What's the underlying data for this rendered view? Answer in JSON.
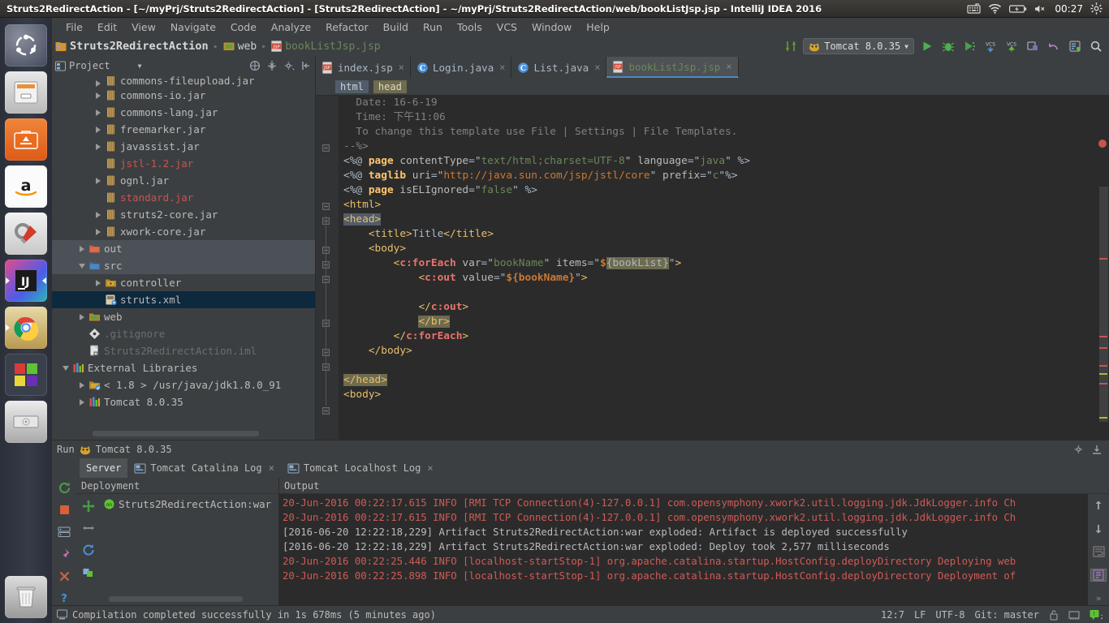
{
  "window": {
    "title": "Struts2RedirectAction - [~/myPrj/Struts2RedirectAction] - [Struts2RedirectAction] - ~/myPrj/Struts2RedirectAction/web/bookListJsp.jsp - IntelliJ IDEA 2016",
    "clock": "00:27"
  },
  "tray": {
    "keyboard": "keyboard-icon",
    "wifi": "wifi-icon",
    "battery": "battery-icon",
    "volume": "volume-muted-icon",
    "settings": "gear-icon"
  },
  "launcher": {
    "items": [
      {
        "name": "ubuntu-dash",
        "label": "Ubuntu Dash"
      },
      {
        "name": "files",
        "label": "Files"
      },
      {
        "name": "software-center",
        "label": "Ubuntu Software Center"
      },
      {
        "name": "amazon",
        "label": "Amazon"
      },
      {
        "name": "system-settings",
        "label": "System Settings"
      },
      {
        "name": "intellij-idea",
        "label": "IntelliJ IDEA"
      },
      {
        "name": "google-chrome",
        "label": "Google Chrome"
      },
      {
        "name": "workspace-switcher",
        "label": "Workspace Switcher"
      },
      {
        "name": "disk-utility",
        "label": "Disks"
      },
      {
        "name": "trash",
        "label": "Trash"
      }
    ]
  },
  "menu": {
    "items": [
      "File",
      "Edit",
      "View",
      "Navigate",
      "Code",
      "Analyze",
      "Refactor",
      "Build",
      "Run",
      "Tools",
      "VCS",
      "Window",
      "Help"
    ]
  },
  "breadcrumb": {
    "project": "Struts2RedirectAction",
    "folder": "web",
    "file": "bookListJsp.jsp"
  },
  "toolbar": {
    "run_config": "Tomcat  8.0.35",
    "buttons": [
      "run-button",
      "debug-button",
      "coverage-button",
      "vcs-update-button",
      "vcs-commit-button",
      "vcs-rollback-button",
      "undo-button",
      "settings-button",
      "search-button"
    ]
  },
  "project_panel": {
    "title": "Project",
    "tree": [
      {
        "label": "commons-fileupload.jar",
        "indent": 2,
        "arrow": "closed",
        "icon": "jar-icon",
        "color": "white",
        "partial": true
      },
      {
        "label": "commons-io.jar",
        "indent": 2,
        "arrow": "closed",
        "icon": "jar-icon",
        "color": "white"
      },
      {
        "label": "commons-lang.jar",
        "indent": 2,
        "arrow": "closed",
        "icon": "jar-icon",
        "color": "white"
      },
      {
        "label": "freemarker.jar",
        "indent": 2,
        "arrow": "closed",
        "icon": "jar-icon",
        "color": "white"
      },
      {
        "label": "javassist.jar",
        "indent": 2,
        "arrow": "closed",
        "icon": "jar-icon",
        "color": "white"
      },
      {
        "label": "jstl-1.2.jar",
        "indent": 2,
        "arrow": "none",
        "icon": "jar-icon",
        "color": "red"
      },
      {
        "label": "ognl.jar",
        "indent": 2,
        "arrow": "closed",
        "icon": "jar-icon",
        "color": "white"
      },
      {
        "label": "standard.jar",
        "indent": 2,
        "arrow": "none",
        "icon": "jar-icon",
        "color": "red"
      },
      {
        "label": "struts2-core.jar",
        "indent": 2,
        "arrow": "closed",
        "icon": "jar-icon",
        "color": "white"
      },
      {
        "label": "xwork-core.jar",
        "indent": 2,
        "arrow": "closed",
        "icon": "jar-icon",
        "color": "white"
      },
      {
        "label": "out",
        "indent": 1,
        "arrow": "closed",
        "icon": "folder-orange-icon",
        "color": "white",
        "row": "sel2"
      },
      {
        "label": "src",
        "indent": 1,
        "arrow": "open",
        "icon": "folder-blue-icon",
        "color": "white",
        "row": "sel2"
      },
      {
        "label": "controller",
        "indent": 2,
        "arrow": "closed",
        "icon": "package-icon",
        "color": "white"
      },
      {
        "label": "struts.xml",
        "indent": 2,
        "arrow": "none",
        "icon": "xml-icon",
        "color": "white",
        "row": "sel"
      },
      {
        "label": "web",
        "indent": 1,
        "arrow": "closed",
        "icon": "folder-web-icon",
        "color": "white"
      },
      {
        "label": ".gitignore",
        "indent": 1,
        "arrow": "none",
        "icon": "git-icon",
        "color": "gray"
      },
      {
        "label": "Struts2RedirectAction.iml",
        "indent": 1,
        "arrow": "none",
        "icon": "iml-icon",
        "color": "gray"
      },
      {
        "label": "External Libraries",
        "indent": 0,
        "arrow": "open",
        "icon": "library-icon",
        "color": "white"
      },
      {
        "label": "< 1.8 > /usr/java/jdk1.8.0_91",
        "indent": 1,
        "arrow": "closed",
        "icon": "jdk-icon",
        "color": "white"
      },
      {
        "label": "Tomcat 8.0.35",
        "indent": 1,
        "arrow": "closed",
        "icon": "library-icon",
        "color": "white"
      }
    ]
  },
  "editor": {
    "tabs": [
      {
        "label": "index.jsp",
        "icon": "jsp-file-icon",
        "active": false
      },
      {
        "label": "Login.java",
        "icon": "java-class-icon",
        "active": false
      },
      {
        "label": "List.java",
        "icon": "java-class-icon",
        "active": false
      },
      {
        "label": "bookListJsp.jsp",
        "icon": "jsp-file-icon",
        "active": true
      }
    ],
    "structure_crumbs": [
      {
        "label": "html",
        "style": "a"
      },
      {
        "label": "head",
        "style": "b"
      }
    ],
    "lines": [
      "  Date: 16-6-19",
      "  Time: 下午11:06",
      "  To change this template use File | Settings | File Templates.",
      "--%>",
      "<%@ page contentType=\"text/html;charset=UTF-8\" language=\"java\" %>",
      "<%@ taglib uri=\"http://java.sun.com/jsp/jstl/core\" prefix=\"c\"%>",
      "<%@ page isELIgnored=\"false\" %>",
      "<html>",
      "<head>",
      "    <title>Title</title>",
      "    <body>",
      "        <c:forEach var=\"bookName\" items=\"${bookList}\">",
      "            <c:out value=\"${bookName}\">",
      "",
      "            </c:out>",
      "            </br>",
      "        </c:forEach>",
      "    </body>",
      "",
      "</head>",
      "<body>"
    ]
  },
  "run_window": {
    "title": "Run",
    "config_label": "Tomcat 8.0.35",
    "tabs": [
      {
        "label": "Server",
        "active": true,
        "closable": false
      },
      {
        "label": "Tomcat Catalina Log",
        "active": false,
        "closable": true
      },
      {
        "label": "Tomcat Localhost Log",
        "active": false,
        "closable": true
      }
    ],
    "deployment": {
      "header": "Deployment",
      "artifact": "Struts2RedirectAction:war"
    },
    "output": {
      "header": "Output",
      "lines": [
        {
          "text": "20-Jun-2016 00:22:17.615 INFO [RMI TCP Connection(4)-127.0.0.1] com.opensymphony.xwork2.util.logging.jdk.JdkLogger.info Ch",
          "type": "error"
        },
        {
          "text": "20-Jun-2016 00:22:17.615 INFO [RMI TCP Connection(4)-127.0.0.1] com.opensymphony.xwork2.util.logging.jdk.JdkLogger.info Ch",
          "type": "error"
        },
        {
          "text": "[2016-06-20 12:22:18,229] Artifact Struts2RedirectAction:war exploded: Artifact is deployed successfully",
          "type": "out"
        },
        {
          "text": "[2016-06-20 12:22:18,229] Artifact Struts2RedirectAction:war exploded: Deploy took 2,577 milliseconds",
          "type": "out"
        },
        {
          "text": "20-Jun-2016 00:22:25.446 INFO [localhost-startStop-1] org.apache.catalina.startup.HostConfig.deployDirectory Deploying web",
          "type": "error"
        },
        {
          "text": "20-Jun-2016 00:22:25.898 INFO [localhost-startStop-1] org.apache.catalina.startup.HostConfig.deployDirectory Deployment of",
          "type": "error"
        }
      ]
    }
  },
  "status_bar": {
    "message": "Compilation completed successfully in 1s 678ms (5 minutes ago)",
    "caret": "12:7",
    "line_sep": "LF",
    "encoding": "UTF-8",
    "vcs": "Git: master"
  }
}
